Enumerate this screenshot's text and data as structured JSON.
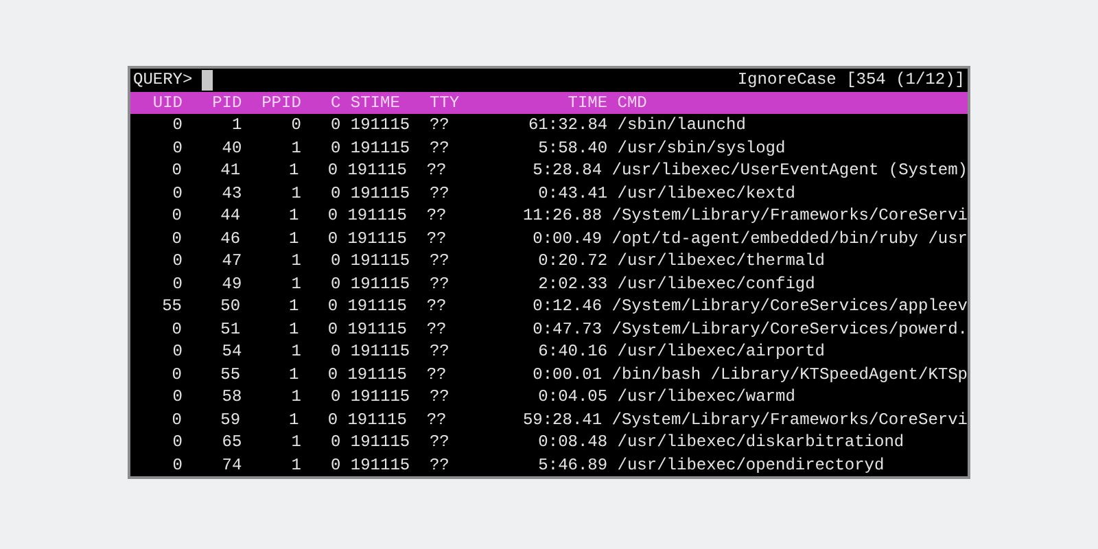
{
  "query": {
    "prompt": "QUERY>",
    "status": "IgnoreCase [354 (1/12)]"
  },
  "table": {
    "columns": [
      "UID",
      "PID",
      "PPID",
      "C",
      "STIME",
      "TTY",
      "TIME",
      "CMD"
    ],
    "rows": [
      [
        "0",
        "1",
        "0",
        "0",
        "191115",
        "??",
        "61:32.84",
        "/sbin/launchd"
      ],
      [
        "0",
        "40",
        "1",
        "0",
        "191115",
        "??",
        "5:58.40",
        "/usr/sbin/syslogd"
      ],
      [
        "0",
        "41",
        "1",
        "0",
        "191115",
        "??",
        "5:28.84",
        "/usr/libexec/UserEventAgent (System)"
      ],
      [
        "0",
        "43",
        "1",
        "0",
        "191115",
        "??",
        "0:43.41",
        "/usr/libexec/kextd"
      ],
      [
        "0",
        "44",
        "1",
        "0",
        "191115",
        "??",
        "11:26.88",
        "/System/Library/Frameworks/CoreServi"
      ],
      [
        "0",
        "46",
        "1",
        "0",
        "191115",
        "??",
        "0:00.49",
        "/opt/td-agent/embedded/bin/ruby /usr"
      ],
      [
        "0",
        "47",
        "1",
        "0",
        "191115",
        "??",
        "0:20.72",
        "/usr/libexec/thermald"
      ],
      [
        "0",
        "49",
        "1",
        "0",
        "191115",
        "??",
        "2:02.33",
        "/usr/libexec/configd"
      ],
      [
        "55",
        "50",
        "1",
        "0",
        "191115",
        "??",
        "0:12.46",
        "/System/Library/CoreServices/appleev"
      ],
      [
        "0",
        "51",
        "1",
        "0",
        "191115",
        "??",
        "0:47.73",
        "/System/Library/CoreServices/powerd."
      ],
      [
        "0",
        "54",
        "1",
        "0",
        "191115",
        "??",
        "6:40.16",
        "/usr/libexec/airportd"
      ],
      [
        "0",
        "55",
        "1",
        "0",
        "191115",
        "??",
        "0:00.01",
        "/bin/bash /Library/KTSpeedAgent/KTSp"
      ],
      [
        "0",
        "58",
        "1",
        "0",
        "191115",
        "??",
        "0:04.05",
        "/usr/libexec/warmd"
      ],
      [
        "0",
        "59",
        "1",
        "0",
        "191115",
        "??",
        "59:28.41",
        "/System/Library/Frameworks/CoreServi"
      ],
      [
        "0",
        "65",
        "1",
        "0",
        "191115",
        "??",
        "0:08.48",
        "/usr/libexec/diskarbitrationd"
      ],
      [
        "0",
        "74",
        "1",
        "0",
        "191115",
        "??",
        "5:46.89",
        "/usr/libexec/opendirectoryd"
      ]
    ]
  }
}
